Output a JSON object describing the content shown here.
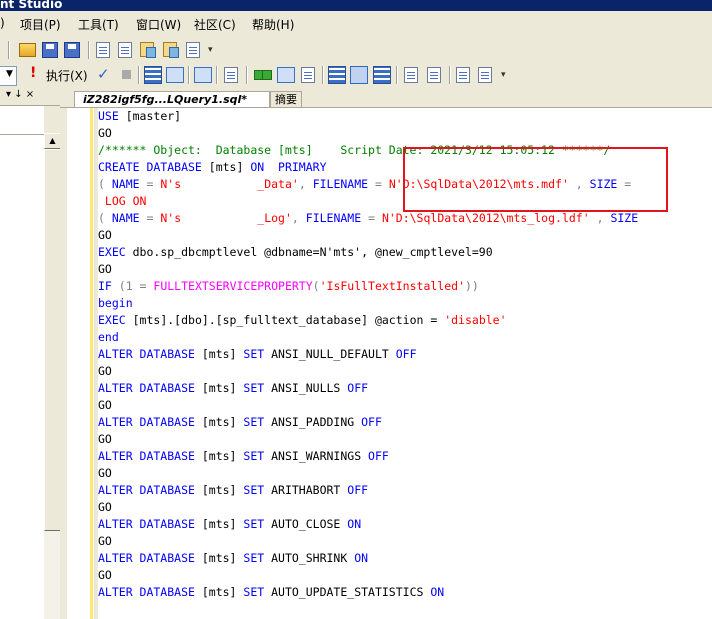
{
  "window": {
    "title_fragment": "nt Studio"
  },
  "menubar": {
    "items": [
      {
        "label": ")"
      },
      {
        "label": "项目(P)"
      },
      {
        "label": "工具(T)"
      },
      {
        "label": "窗口(W)"
      },
      {
        "label": "社区(C)"
      },
      {
        "label": "帮助(H)"
      }
    ]
  },
  "toolbar2": {
    "execute_label": "执行(X)"
  },
  "left_panel": {
    "controls": "▾ ↓ ×"
  },
  "tabs": [
    {
      "label": "iZ282igf5fg...LQuery1.sql*"
    },
    {
      "label": "摘要"
    }
  ],
  "code": {
    "lines": [
      {
        "tokens": [
          {
            "t": "USE",
            "c": "k"
          },
          {
            "t": " [master]",
            "c": "d"
          }
        ]
      },
      {
        "tokens": [
          {
            "t": "GO",
            "c": "d"
          }
        ]
      },
      {
        "tokens": [
          {
            "t": "/****** Object:  Database [mts]    Script Date: 2021/3/12 15:05:12 ******/",
            "c": "c"
          }
        ]
      },
      {
        "tokens": [
          {
            "t": "CREATE DATABASE",
            "c": "k"
          },
          {
            "t": " [mts] ",
            "c": "d"
          },
          {
            "t": "ON  PRIMARY",
            "c": "k"
          }
        ]
      },
      {
        "tokens": [
          {
            "t": "( ",
            "c": "g"
          },
          {
            "t": "NAME",
            "c": "k"
          },
          {
            "t": " = ",
            "c": "g"
          },
          {
            "t": "N's           _Data'",
            "c": "r"
          },
          {
            "t": ", ",
            "c": "g"
          },
          {
            "t": "FILENAME",
            "c": "k"
          },
          {
            "t": " = ",
            "c": "g"
          },
          {
            "t": "N'D:\\SqlData\\2012\\mts.mdf'",
            "c": "r"
          },
          {
            "t": " , ",
            "c": "g"
          },
          {
            "t": "SIZE",
            "c": "k"
          },
          {
            "t": " =",
            "c": "g"
          }
        ]
      },
      {
        "tokens": [
          {
            "t": " LOG ON",
            "c": "r"
          }
        ]
      },
      {
        "tokens": [
          {
            "t": "( ",
            "c": "g"
          },
          {
            "t": "NAME",
            "c": "k"
          },
          {
            "t": " = ",
            "c": "g"
          },
          {
            "t": "N's           _Log'",
            "c": "r"
          },
          {
            "t": ", ",
            "c": "g"
          },
          {
            "t": "FILENAME",
            "c": "k"
          },
          {
            "t": " = ",
            "c": "g"
          },
          {
            "t": "N'D:\\SqlData\\2012\\mts_log.ldf'",
            "c": "r"
          },
          {
            "t": " , ",
            "c": "g"
          },
          {
            "t": "SIZE",
            "c": "k"
          }
        ]
      },
      {
        "tokens": [
          {
            "t": "GO",
            "c": "d"
          }
        ]
      },
      {
        "tokens": [
          {
            "t": "EXEC",
            "c": "k"
          },
          {
            "t": " dbo.sp_dbcmptlevel @dbname=N'mts', @new_cmptlevel=90",
            "c": "d"
          }
        ]
      },
      {
        "tokens": [
          {
            "t": "GO",
            "c": "d"
          }
        ]
      },
      {
        "tokens": [
          {
            "t": "IF",
            "c": "k"
          },
          {
            "t": " (1 = ",
            "c": "g"
          },
          {
            "t": "FULLTEXTSERVICEPROPERTY",
            "c": "m"
          },
          {
            "t": "(",
            "c": "g"
          },
          {
            "t": "'IsFullTextInstalled'",
            "c": "r"
          },
          {
            "t": "))",
            "c": "g"
          }
        ]
      },
      {
        "tokens": [
          {
            "t": "begin",
            "c": "k"
          }
        ]
      },
      {
        "tokens": [
          {
            "t": "EXEC",
            "c": "k"
          },
          {
            "t": " [mts].[dbo].[sp_fulltext_database] @action = ",
            "c": "d"
          },
          {
            "t": "'disable'",
            "c": "r"
          }
        ]
      },
      {
        "tokens": [
          {
            "t": "end",
            "c": "k"
          }
        ]
      },
      {
        "tokens": [
          {
            "t": "ALTER DATABASE",
            "c": "k"
          },
          {
            "t": " [mts] ",
            "c": "d"
          },
          {
            "t": "SET",
            "c": "k"
          },
          {
            "t": " ANSI_NULL_DEFAULT ",
            "c": "d"
          },
          {
            "t": "OFF",
            "c": "k"
          }
        ]
      },
      {
        "tokens": [
          {
            "t": "GO",
            "c": "d"
          }
        ]
      },
      {
        "tokens": [
          {
            "t": "ALTER DATABASE",
            "c": "k"
          },
          {
            "t": " [mts] ",
            "c": "d"
          },
          {
            "t": "SET",
            "c": "k"
          },
          {
            "t": " ANSI_NULLS ",
            "c": "d"
          },
          {
            "t": "OFF",
            "c": "k"
          }
        ]
      },
      {
        "tokens": [
          {
            "t": "GO",
            "c": "d"
          }
        ]
      },
      {
        "tokens": [
          {
            "t": "ALTER DATABASE",
            "c": "k"
          },
          {
            "t": " [mts] ",
            "c": "d"
          },
          {
            "t": "SET",
            "c": "k"
          },
          {
            "t": " ANSI_PADDING ",
            "c": "d"
          },
          {
            "t": "OFF",
            "c": "k"
          }
        ]
      },
      {
        "tokens": [
          {
            "t": "GO",
            "c": "d"
          }
        ]
      },
      {
        "tokens": [
          {
            "t": "ALTER DATABASE",
            "c": "k"
          },
          {
            "t": " [mts] ",
            "c": "d"
          },
          {
            "t": "SET",
            "c": "k"
          },
          {
            "t": " ANSI_WARNINGS ",
            "c": "d"
          },
          {
            "t": "OFF",
            "c": "k"
          }
        ]
      },
      {
        "tokens": [
          {
            "t": "GO",
            "c": "d"
          }
        ]
      },
      {
        "tokens": [
          {
            "t": "ALTER DATABASE",
            "c": "k"
          },
          {
            "t": " [mts] ",
            "c": "d"
          },
          {
            "t": "SET",
            "c": "k"
          },
          {
            "t": " ARITHABORT ",
            "c": "d"
          },
          {
            "t": "OFF",
            "c": "k"
          }
        ]
      },
      {
        "tokens": [
          {
            "t": "GO",
            "c": "d"
          }
        ]
      },
      {
        "tokens": [
          {
            "t": "ALTER DATABASE",
            "c": "k"
          },
          {
            "t": " [mts] ",
            "c": "d"
          },
          {
            "t": "SET",
            "c": "k"
          },
          {
            "t": " AUTO_CLOSE ",
            "c": "d"
          },
          {
            "t": "ON",
            "c": "k"
          }
        ]
      },
      {
        "tokens": [
          {
            "t": "GO",
            "c": "d"
          }
        ]
      },
      {
        "tokens": [
          {
            "t": "ALTER DATABASE",
            "c": "k"
          },
          {
            "t": " [mts] ",
            "c": "d"
          },
          {
            "t": "SET",
            "c": "k"
          },
          {
            "t": " AUTO_SHRINK ",
            "c": "d"
          },
          {
            "t": "ON",
            "c": "k"
          }
        ]
      },
      {
        "tokens": [
          {
            "t": "GO",
            "c": "d"
          }
        ]
      },
      {
        "tokens": [
          {
            "t": "ALTER DATABASE",
            "c": "k"
          },
          {
            "t": " [mts] ",
            "c": "d"
          },
          {
            "t": "SET",
            "c": "k"
          },
          {
            "t": " AUTO_UPDATE_STATISTICS ",
            "c": "d"
          },
          {
            "t": "ON",
            "c": "k"
          }
        ]
      }
    ]
  },
  "annotation": {
    "color": "#e0161c"
  },
  "colors": {
    "keyword": "#0000ff",
    "function": "#ff00ff",
    "string": "#ff0000",
    "comment": "#008000",
    "operator": "#808080",
    "chrome": "#ece9d8"
  }
}
